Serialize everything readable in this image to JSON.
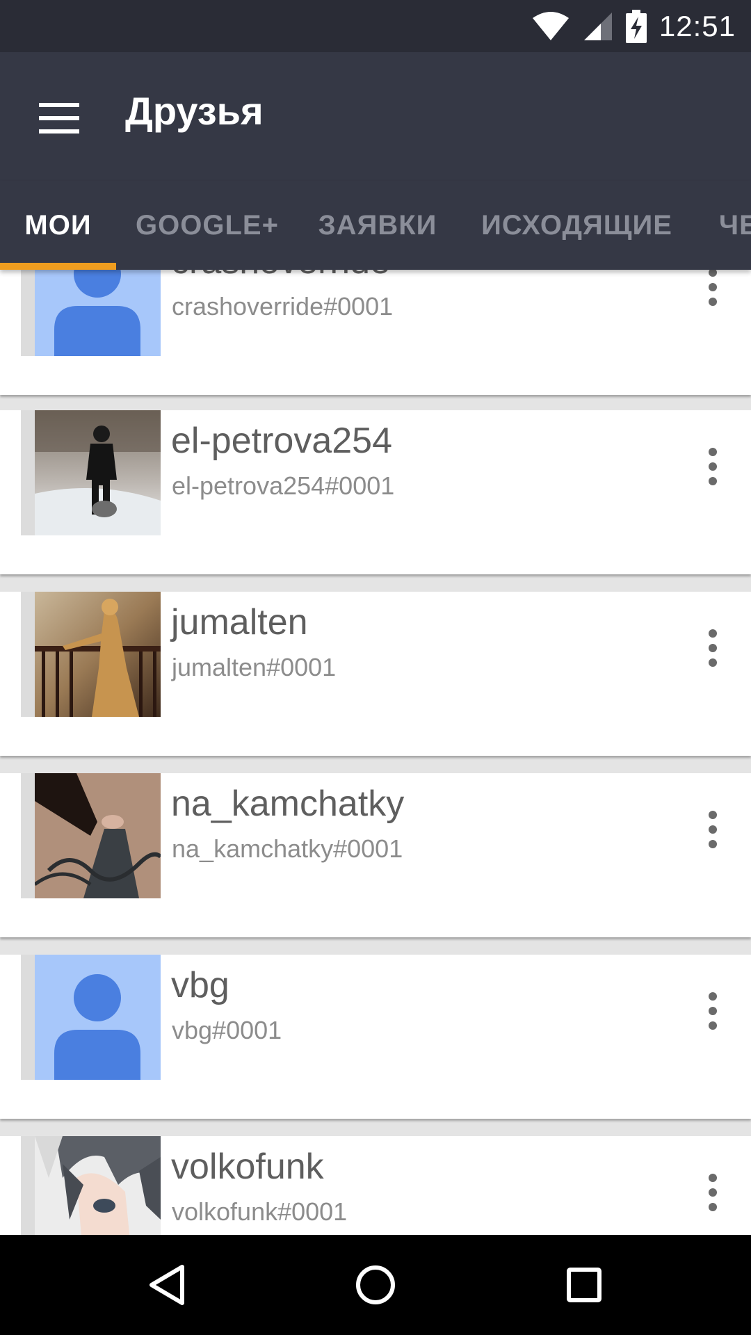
{
  "status_bar": {
    "time": "12:51",
    "icons": [
      "wifi-icon",
      "cell-signal-icon",
      "battery-charging-icon"
    ]
  },
  "toolbar": {
    "title": "Друзья",
    "menu_icon": "hamburger-menu-icon"
  },
  "tabs": [
    {
      "label": "МОИ",
      "active": true
    },
    {
      "label": "GOOGLE+",
      "active": false
    },
    {
      "label": "ЗАЯВКИ",
      "active": false
    },
    {
      "label": "ИСХОДЯЩИЕ",
      "active": false
    },
    {
      "label": "ЧЕ",
      "active": false
    }
  ],
  "friends": [
    {
      "name": "crashoverride",
      "handle": "crashoverride#0001",
      "avatar": "default-person-icon"
    },
    {
      "name": "el-petrova254",
      "handle": "el-petrova254#0001",
      "avatar": "photo-snow-dog"
    },
    {
      "name": "jumalten",
      "handle": "jumalten#0001",
      "avatar": "photo-woman-railing"
    },
    {
      "name": "na_kamchatky",
      "handle": "na_kamchatky#0001",
      "avatar": "photo-stair-railing"
    },
    {
      "name": "vbg",
      "handle": "vbg#0001",
      "avatar": "default-person-icon"
    },
    {
      "name": "volkofunk",
      "handle": "volkofunk#0001",
      "avatar": "anime-character"
    }
  ],
  "nav_bar": [
    "back-icon",
    "home-icon",
    "recents-icon"
  ],
  "colors": {
    "status_bar": "#2a2c36",
    "toolbar": "#353845",
    "tab_indicator": "#ef9d1f",
    "placeholder_avatar_bg": "#a7c7fa",
    "placeholder_avatar_fg": "#4a7fe0"
  }
}
